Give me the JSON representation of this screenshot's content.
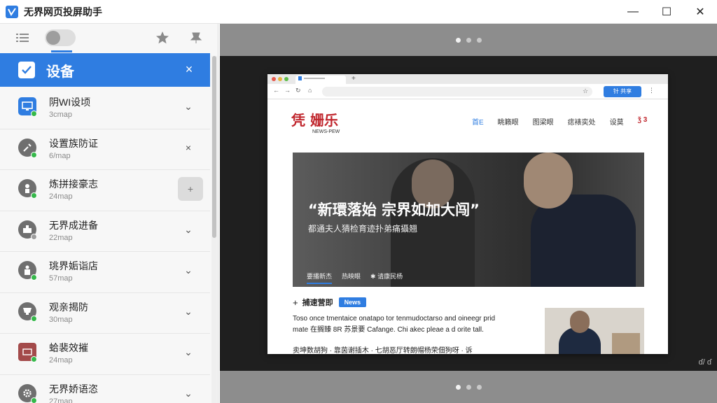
{
  "app": {
    "title": "无界网页投屏助手",
    "window_controls": {
      "minimize": "—",
      "maximize": "☐",
      "close": "✕"
    }
  },
  "sidebar": {
    "header": {
      "label": "设备",
      "close": "×"
    },
    "devices": [
      {
        "name": "阴WI设顷",
        "sub": "3cmap",
        "action": "⌄",
        "icon": "monitor-icon",
        "status": "online"
      },
      {
        "name": "设置族防证",
        "sub": "6/map",
        "action": "×",
        "icon": "tools-icon",
        "status": "online"
      },
      {
        "name": "炼拼接豪志",
        "sub": "24map",
        "action": "+",
        "icon": "person-icon",
        "status": "online"
      },
      {
        "name": "无界成进备",
        "sub": "22map",
        "action": "⌄",
        "icon": "box-icon",
        "status": "offline"
      },
      {
        "name": "珧界姤诣店",
        "sub": "57map",
        "action": "⌄",
        "icon": "user-icon",
        "status": "online"
      },
      {
        "name": "观亲揭防",
        "sub": "30map",
        "action": "⌄",
        "icon": "cup-icon",
        "status": "online"
      },
      {
        "name": "蛤裴效摧",
        "sub": "24map",
        "action": "⌄",
        "icon": "card-icon",
        "status": "online"
      },
      {
        "name": "无界娇语恣",
        "sub": "27map",
        "action": "⌄",
        "icon": "gear-icon",
        "status": "online"
      }
    ]
  },
  "browser": {
    "share_label": "针 共享",
    "site": {
      "logo_main": "凭 姗乐",
      "logo_sub": "NEWS-PEW",
      "nav": [
        "首E",
        "眺籁眼",
        "图梁眼",
        "痣裱奕处",
        "设莫",
        "ǯ 3"
      ],
      "hero_title": "“新環落始  宗界如加大闯”",
      "hero_sub": "都通夫人猜检育迹扑弟痛攝翘",
      "hero_tabs": [
        "要播新杰",
        "热映眼",
        "✱ 请康民杨"
      ],
      "news_title": "捕速营即",
      "news_badge": "News",
      "news_line1": "Toso once tmentaice onatapo tor tenmudoctarso and oineegr prid",
      "news_line2": "mate   在搁臻  8R 苏景要 Cafange.   Chi akec pleae a d orite tall.",
      "news_line3": "卖坤数胡狗 · 靠茵谢插木 · 七胡恶厅转朗帽杨荣佃狗呀 · 诉"
    }
  },
  "preview": {
    "cast_label": "ɗ/ ɗ"
  }
}
